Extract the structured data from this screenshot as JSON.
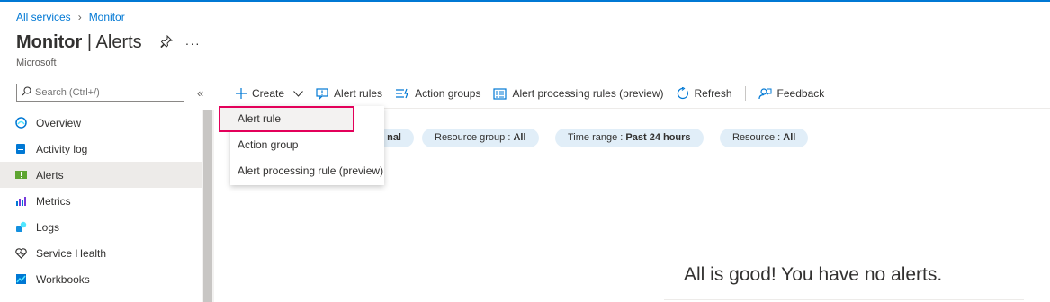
{
  "breadcrumb": {
    "items": [
      "All services",
      "Monitor"
    ]
  },
  "header": {
    "title_bold": "Monitor",
    "title_sep": " | ",
    "title_rest": "Alerts",
    "subtitle": "Microsoft"
  },
  "search": {
    "placeholder": "Search (Ctrl+/)"
  },
  "sidebar": {
    "items": [
      {
        "label": "Overview",
        "icon": "overview-icon"
      },
      {
        "label": "Activity log",
        "icon": "activity-log-icon"
      },
      {
        "label": "Alerts",
        "icon": "alerts-icon",
        "active": true
      },
      {
        "label": "Metrics",
        "icon": "metrics-icon"
      },
      {
        "label": "Logs",
        "icon": "logs-icon"
      },
      {
        "label": "Service Health",
        "icon": "heart-icon"
      },
      {
        "label": "Workbooks",
        "icon": "workbooks-icon"
      }
    ]
  },
  "toolbar": {
    "create": "Create",
    "alert_rules": "Alert rules",
    "action_groups": "Action groups",
    "alert_processing_rules": "Alert processing rules (preview)",
    "refresh": "Refresh",
    "feedback": "Feedback"
  },
  "filters": {
    "partial_visible": "nal",
    "resource_group_label": "Resource group : ",
    "resource_group_value": "All",
    "time_range_label": "Time range : ",
    "time_range_value": "Past 24 hours",
    "resource_label": "Resource : ",
    "resource_value": "All"
  },
  "create_menu": {
    "items": [
      "Alert rule",
      "Action group",
      "Alert processing rule (preview)"
    ],
    "highlighted": "Alert rule"
  },
  "empty_state": {
    "message": "All is good! You have no alerts."
  },
  "colors": {
    "accent": "#0078d4",
    "highlight_border": "#e3005a",
    "pill_bg": "#e1eef8"
  }
}
